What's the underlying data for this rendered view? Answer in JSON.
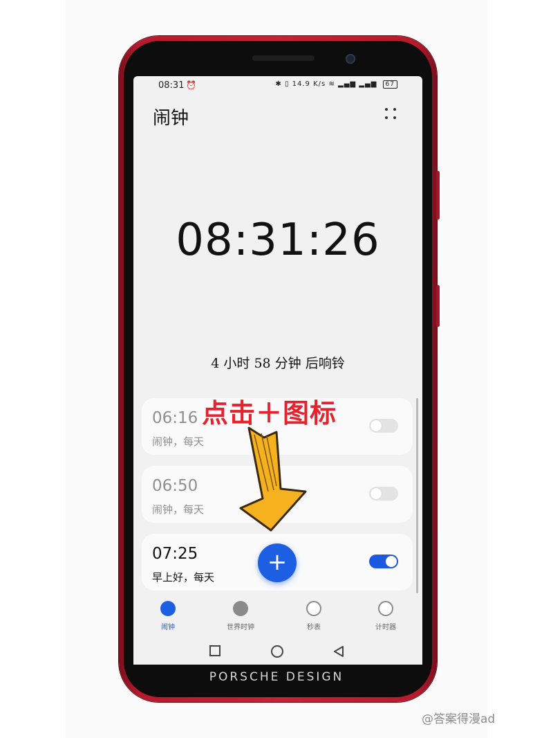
{
  "status_bar": {
    "time": "08:31",
    "alarm_icon": "alarm-clock-icon",
    "speed": "14.9 K/s",
    "battery": "67"
  },
  "app": {
    "title": "闹钟"
  },
  "clock": {
    "current_time": "08:31:26",
    "countdown": "4 小时 58 分钟 后响铃"
  },
  "alarms": [
    {
      "time": "06:16",
      "label": "闹钟，每天",
      "enabled": false
    },
    {
      "time": "06:50",
      "label": "闹钟，每天",
      "enabled": false
    },
    {
      "time": "07:25",
      "label": "早上好，每天",
      "enabled": true
    }
  ],
  "fab": {
    "label": "+"
  },
  "tabs": [
    {
      "label": "闹钟",
      "icon": "alarm-clock-icon",
      "active": true
    },
    {
      "label": "世界时钟",
      "icon": "globe-icon",
      "active": false
    },
    {
      "label": "秒表",
      "icon": "stopwatch-icon",
      "active": false
    },
    {
      "label": "计时器",
      "icon": "timer-icon",
      "active": false
    }
  ],
  "device": {
    "brand": "PORSCHE DESIGN"
  },
  "annotation": {
    "text": "点击＋图标"
  },
  "watermark": "@答案得漫ad",
  "colors": {
    "accent": "#1c5fe3",
    "annotation_red": "#e5232f",
    "arrow_yellow": "#f5b21e",
    "phone_red": "#c72235"
  }
}
